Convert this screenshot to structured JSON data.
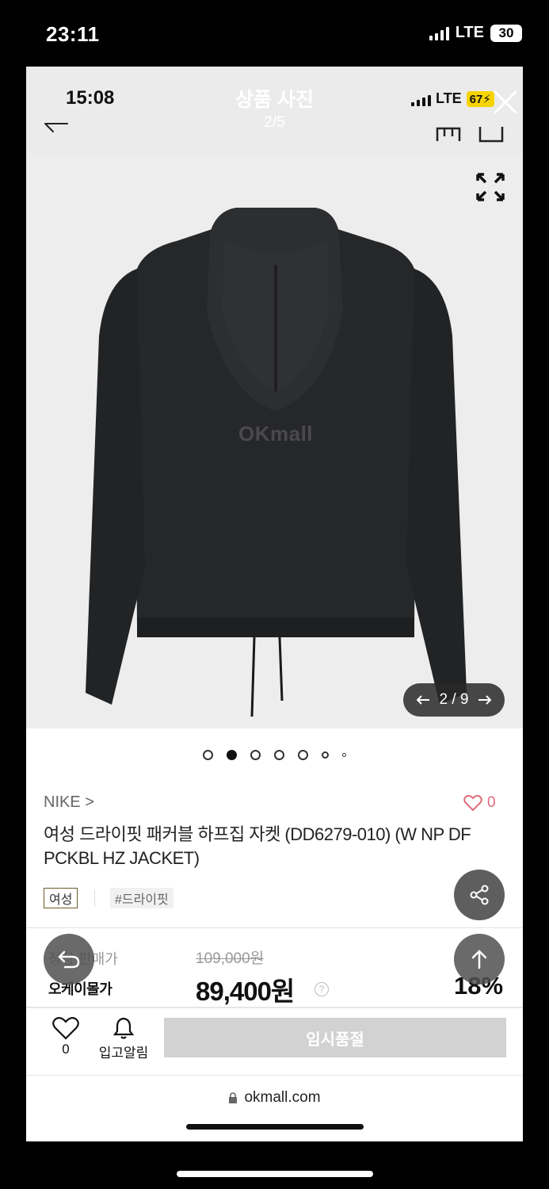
{
  "outer_status": {
    "time": "23:11",
    "network": "LTE",
    "battery": "30"
  },
  "viewer": {
    "time": "15:08",
    "title": "상품 사진",
    "counter": "2/5",
    "network": "LTE",
    "battery": "67"
  },
  "product_image": {
    "watermark": "OKmall",
    "position": "2 / 9",
    "dots_total": 7,
    "dots_active_index": 1
  },
  "product": {
    "brand": "NIKE >",
    "likes": "0",
    "name": "여성 드라이핏 패커블 하프집 자켓 (DD6279-010) (W NP DF PCKBL HZ JACKET)",
    "tag_gender": "여성",
    "tag_hash": "#드라이핏"
  },
  "price": {
    "list_label": "정상 판매가",
    "list_price": "109,000원",
    "sale_label": "오케이몰가",
    "sale_price": "89,400원",
    "help": "?",
    "discount": "18%"
  },
  "actions": {
    "wish_count": "0",
    "alarm_label": "입고알림",
    "soldout_label": "임시품절"
  },
  "browser": {
    "url": "okmall.com"
  },
  "icons": [
    "close-icon",
    "back-arrow-icon",
    "shopping-bag-icon",
    "cart-icon",
    "expand-icon",
    "arrow-left-icon",
    "arrow-right-icon",
    "heart-icon",
    "share-icon",
    "arrow-up-icon",
    "undo-icon",
    "bell-icon",
    "lock-icon",
    "help-icon"
  ]
}
